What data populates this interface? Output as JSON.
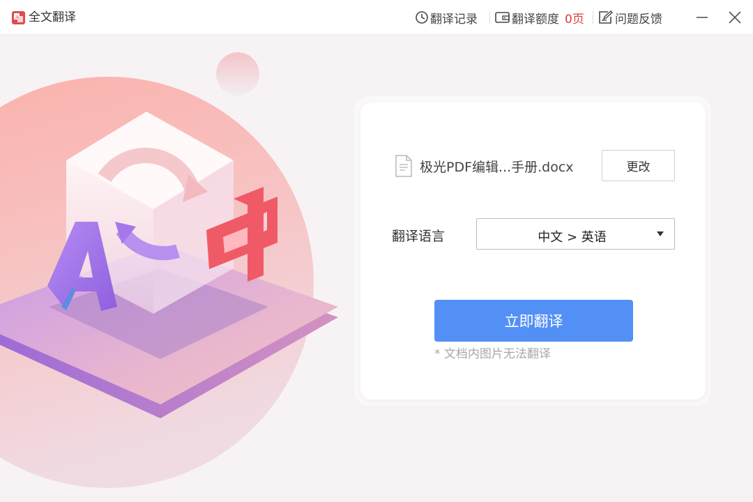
{
  "app": {
    "title": "全文翻译",
    "logo_icon": "document-translate-icon"
  },
  "toolbar": {
    "history_label": "翻译记录",
    "history_icon": "clock-icon",
    "quota_label": "翻译额度",
    "quota_icon": "wallet-icon",
    "quota_value": "0页",
    "feedback_label": "问题反馈",
    "feedback_icon": "edit-icon",
    "minimize_icon": "minimize-icon",
    "close_icon": "close-icon"
  },
  "file": {
    "icon": "file-icon",
    "name": "极光PDF编辑...手册.docx",
    "change_label": "更改"
  },
  "language": {
    "label": "翻译语言",
    "selected": "中文 > 英语"
  },
  "action": {
    "translate_label": "立即翻译",
    "note": "* 文档内图片无法翻译"
  },
  "colors": {
    "accent": "#5390f6",
    "quota": "#e03a3a",
    "note": "#a8a8a8"
  }
}
